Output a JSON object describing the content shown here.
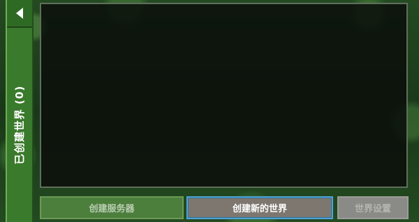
{
  "sidebar": {
    "back_icon": "back-arrow-icon",
    "tab_label": "已创建世界 (0)"
  },
  "world_list": {
    "items": []
  },
  "buttons": {
    "create_server": "创建服务器",
    "create_new_world": "创建新的世界",
    "world_settings": "世界设置"
  },
  "colors": {
    "sidebar_green": "#3a7a2c",
    "selected_border": "#4fa3d6",
    "panel_dark": "#0a0e0a"
  }
}
